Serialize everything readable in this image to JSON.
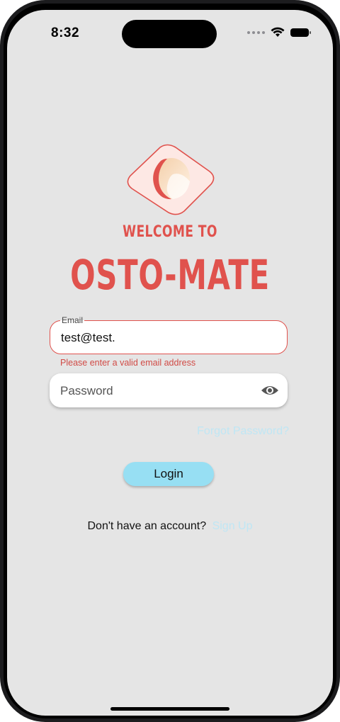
{
  "status_bar": {
    "time": "8:32",
    "icons": [
      "signal-dots-icon",
      "wifi-icon",
      "battery-icon"
    ]
  },
  "branding": {
    "welcome": "WELCOME TO",
    "app_name": "OSTO-MATE",
    "logo_icon": "osto-mate-logo-icon"
  },
  "email_field": {
    "label": "Email",
    "value": "test@test.",
    "error": "Please enter a valid email address"
  },
  "password_field": {
    "placeholder": "Password",
    "toggle_icon": "eye-icon"
  },
  "forgot_password": "Forgot Password?",
  "login_button": "Login",
  "signup": {
    "prompt": "Don't have an account?",
    "link": "Sign Up"
  },
  "colors": {
    "brand_red": "#e0524d",
    "accent_blue": "#97dff3",
    "link_blue": "#bfe6f4",
    "background": "#e5e5e5"
  }
}
